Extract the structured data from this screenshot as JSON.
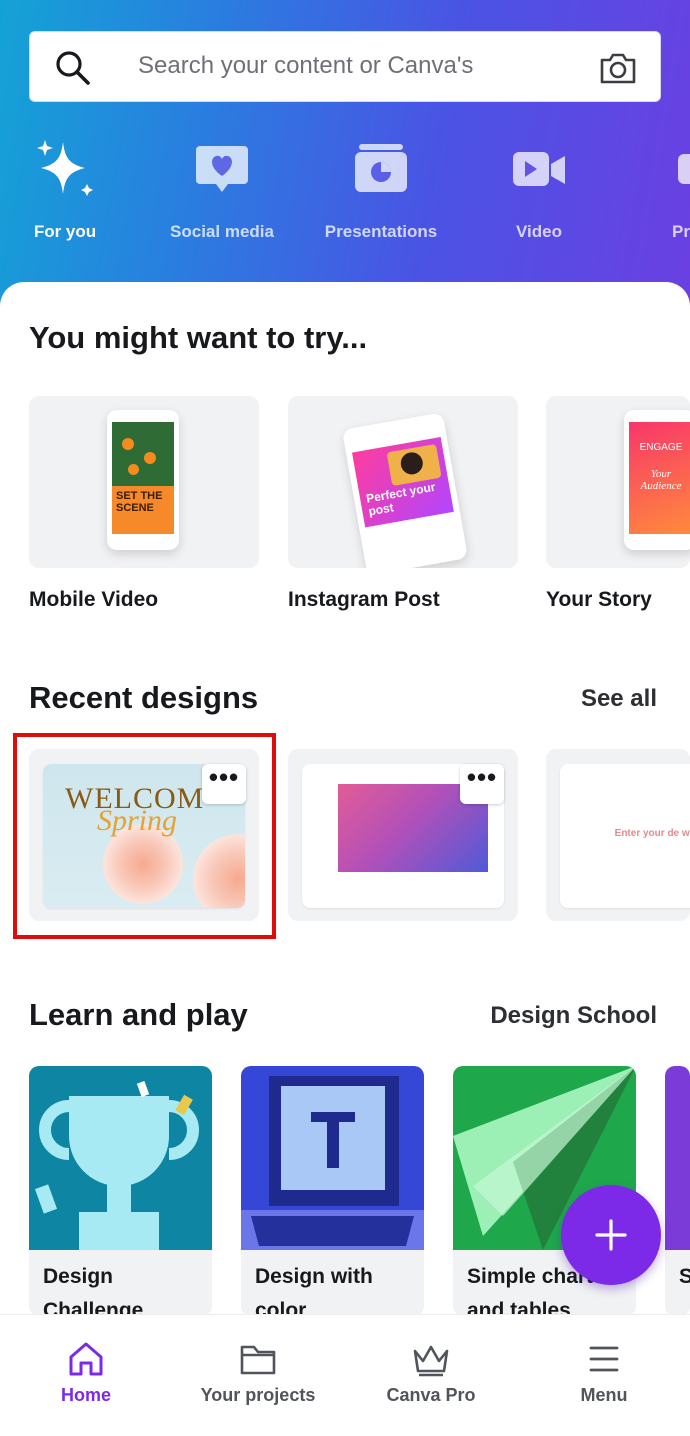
{
  "search": {
    "placeholder": "Search your content or Canva's"
  },
  "categories": [
    {
      "label": "For you",
      "icon": "sparkle-icon",
      "active": true
    },
    {
      "label": "Social media",
      "icon": "heart-chat-icon"
    },
    {
      "label": "Presentations",
      "icon": "presentation-icon"
    },
    {
      "label": "Video",
      "icon": "video-camera-icon"
    },
    {
      "label": "Pr",
      "icon": "print-icon"
    }
  ],
  "try_section": {
    "title": "You might want to try...",
    "items": [
      {
        "label": "Mobile Video",
        "thumb_text": "SET THE SCENE"
      },
      {
        "label": "Instagram Post",
        "thumb_text": "Perfect your post"
      },
      {
        "label": "Your Story",
        "thumb_text_1": "ENGAGE",
        "thumb_text_2": "Your Audience"
      }
    ]
  },
  "recent": {
    "title": "Recent designs",
    "see_all": "See all",
    "more_label": "•••",
    "items": [
      {
        "thumb_text_1": "WELCOM",
        "thumb_text_2": "Spring"
      },
      {},
      {
        "thumb_text": "Enter your de words"
      }
    ]
  },
  "learn": {
    "title": "Learn and play",
    "link": "Design School",
    "items": [
      {
        "caption": "Design Challenge"
      },
      {
        "caption": "Design with color"
      },
      {
        "caption": "Simple charts and tables"
      },
      {
        "caption": "S v"
      }
    ]
  },
  "fab": {
    "icon": "plus-icon"
  },
  "nav": [
    {
      "label": "Home",
      "icon": "home-icon",
      "active": true
    },
    {
      "label": "Your projects",
      "icon": "folder-icon"
    },
    {
      "label": "Canva Pro",
      "icon": "crown-icon"
    },
    {
      "label": "Menu",
      "icon": "menu-icon"
    }
  ],
  "colors": {
    "accent": "#7d2ae8",
    "highlight": "#e00b0b"
  }
}
